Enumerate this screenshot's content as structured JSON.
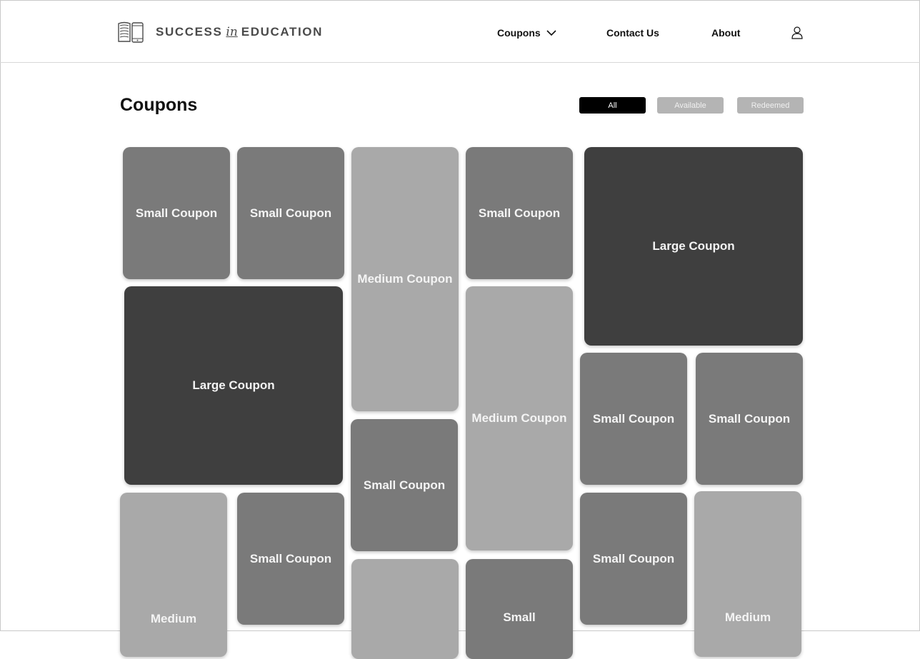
{
  "brand": {
    "name_part1": "SUCCESS",
    "name_part2": "in",
    "name_part3": "EDUCATION",
    "logo_icon": "book-and-phone-icon"
  },
  "nav": {
    "coupons": "Coupons",
    "contact": "Contact Us",
    "about": "About",
    "dropdown_icon": "chevron-down-icon",
    "user_icon": "user-icon"
  },
  "page": {
    "title": "Coupons"
  },
  "filters": {
    "all": "All",
    "available": "Available",
    "redeemed": "Redeemed",
    "active": "All"
  },
  "coupons": {
    "small": "Small Coupon",
    "medium": "Medium Coupon",
    "large": "Large Coupon",
    "medium_partial": "Medium",
    "small_partial": "Small"
  },
  "colors": {
    "small_coupon": "#7a7a7a",
    "medium_coupon": "#a9a9a9",
    "large_coupon": "#3f3f3f",
    "active_filter": "#000000",
    "inactive_filter": "#b4b4b4"
  }
}
